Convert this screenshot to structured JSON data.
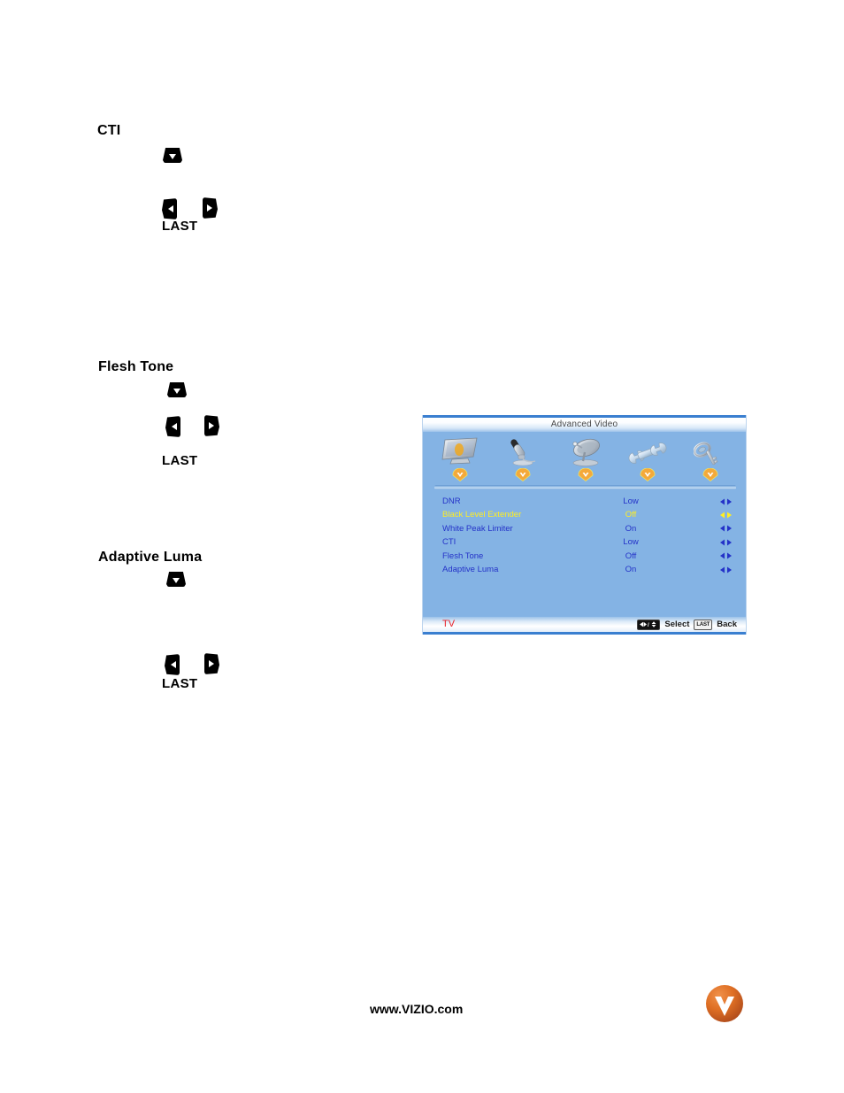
{
  "page": {
    "footer_url": "www.VIZIO.com",
    "logo_name": "vizio-logo"
  },
  "sections": [
    {
      "heading": "CTI",
      "last_label": "LAST"
    },
    {
      "heading": "Flesh Tone",
      "last_label": "LAST"
    },
    {
      "heading": "Adaptive Luma",
      "last_label": "LAST"
    }
  ],
  "osd": {
    "title": "Advanced Video",
    "source_label": "TV",
    "hints": {
      "select_keycap": "◀▶/▲▼",
      "select_label": "Select",
      "back_keycap": "LAST",
      "back_label": "Back"
    },
    "icon_tabs": [
      {
        "name": "picture-settings-icon",
        "label": ""
      },
      {
        "name": "audio-settings-icon",
        "label": ""
      },
      {
        "name": "tuner-settings-icon",
        "label": ""
      },
      {
        "name": "setup-settings-icon",
        "label": ""
      },
      {
        "name": "parental-controls-icon",
        "label": ""
      }
    ],
    "rows": [
      {
        "label": "DNR",
        "value": "Low",
        "selected": false
      },
      {
        "label": "Black Level Extender",
        "value": "Off",
        "selected": true
      },
      {
        "label": "White Peak Limiter",
        "value": "On",
        "selected": false
      },
      {
        "label": "CTI",
        "value": "Low",
        "selected": false
      },
      {
        "label": "Flesh Tone",
        "value": "Off",
        "selected": false
      },
      {
        "label": "Adaptive Luma",
        "value": "On",
        "selected": false
      }
    ],
    "colors": {
      "panel_bg": "#84b3e4",
      "text_blue": "#2432c8",
      "text_highlight": "#ffee22",
      "source_red": "#e8222a",
      "border_blue": "#3a7fd0"
    }
  }
}
